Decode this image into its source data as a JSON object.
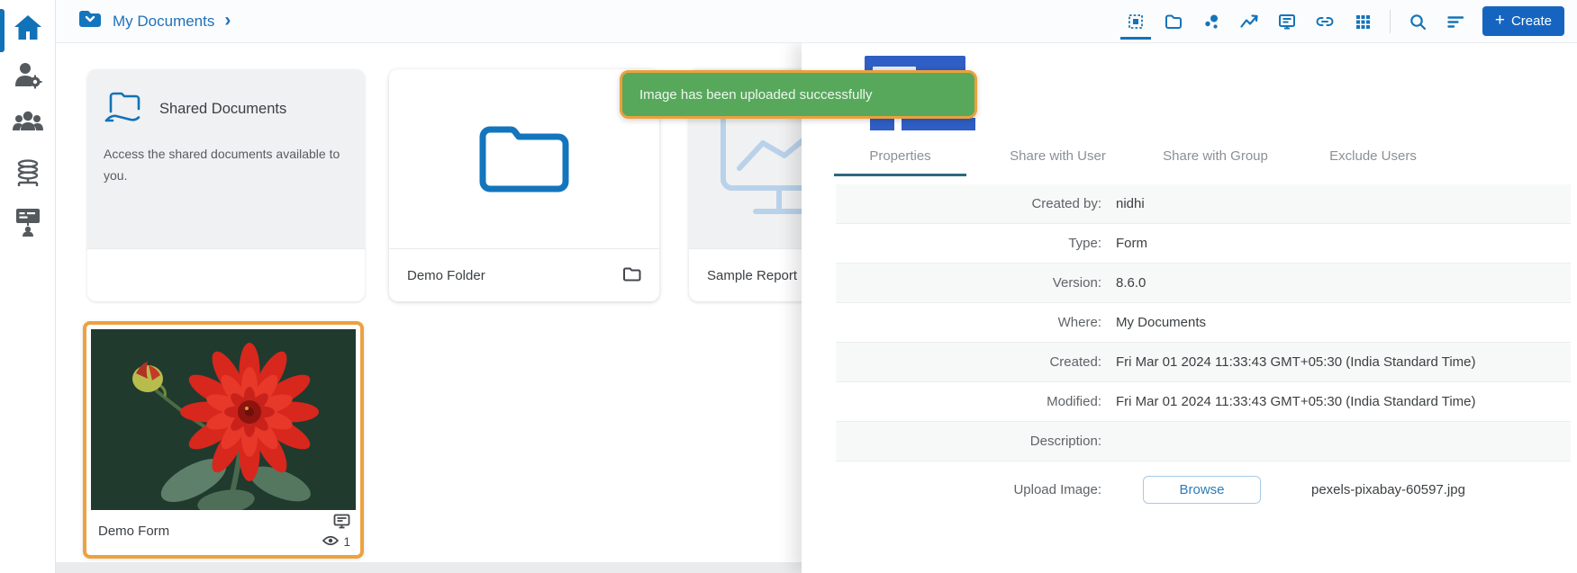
{
  "colors": {
    "primary_blue": "#1272b8",
    "create_button_blue": "#1565c0",
    "toast_green": "#57a85b",
    "highlight_orange": "#eca23f",
    "tab_underline": "#2d6880",
    "thumbnail_blue": "#2f5ec4"
  },
  "sidebar": {
    "icons": [
      "home-icon",
      "user-settings-icon",
      "groups-icon",
      "server-icon",
      "training-board-icon"
    ],
    "active_item": "home"
  },
  "topbar": {
    "breadcrumb": {
      "icon": "folder-dropdown-icon",
      "label": "My Documents",
      "separator": "›"
    },
    "view_icons": [
      "widgets-icon",
      "folder-icon",
      "bubbles-icon",
      "line-chart-icon",
      "form-board-icon",
      "link-icon",
      "grid-icon",
      "search-icon",
      "sort-icon"
    ],
    "active_view_icon": "widgets-icon",
    "create": {
      "plus": "+",
      "label": "Create"
    }
  },
  "toast": {
    "message": "Image has been uploaded successfully"
  },
  "cards": {
    "shared": {
      "title": "Shared Documents",
      "description": "Access the shared documents available to you.",
      "icon": "shared-folder-hand-icon"
    },
    "folder": {
      "title": "Demo Folder",
      "icon": "folder-icon"
    },
    "report": {
      "title": "Sample Report",
      "icon": "report-monitor-icon"
    },
    "form": {
      "title": "Demo Form",
      "view_count": "1",
      "icons": [
        "form-icon",
        "eye-icon"
      ]
    }
  },
  "panel": {
    "tabs": [
      {
        "label": "Properties",
        "active": true
      },
      {
        "label": "Share with User",
        "active": false
      },
      {
        "label": "Share with Group",
        "active": false
      },
      {
        "label": "Exclude Users",
        "active": false
      }
    ],
    "properties": [
      {
        "label": "Created by:",
        "value": "nidhi"
      },
      {
        "label": "Type:",
        "value": "Form"
      },
      {
        "label": "Version:",
        "value": "8.6.0"
      },
      {
        "label": "Where:",
        "value": "My Documents"
      },
      {
        "label": "Created:",
        "value": "Fri Mar 01 2024 11:33:43 GMT+05:30 (India Standard Time)"
      },
      {
        "label": "Modified:",
        "value": "Fri Mar 01 2024 11:33:43 GMT+05:30 (India Standard Time)"
      },
      {
        "label": "Description:",
        "value": ""
      }
    ],
    "upload": {
      "label": "Upload Image:",
      "button": "Browse",
      "filename": "pexels-pixabay-60597.jpg"
    }
  }
}
